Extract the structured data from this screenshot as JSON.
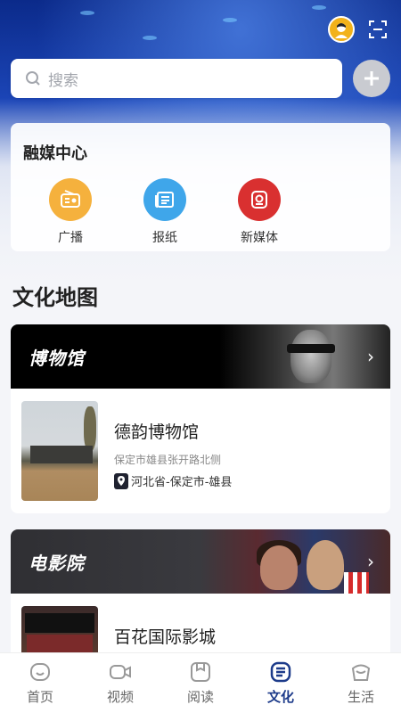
{
  "search": {
    "placeholder": "搜索"
  },
  "media_center": {
    "title": "融媒中心",
    "items": [
      {
        "label": "广播",
        "icon": "radio-icon",
        "color": "#f5b13d"
      },
      {
        "label": "报纸",
        "icon": "newspaper-icon",
        "color": "#3fa6ea"
      },
      {
        "label": "新媒体",
        "icon": "new-media-icon",
        "color": "#d93030"
      }
    ]
  },
  "culture_map": {
    "title": "文化地图",
    "categories": [
      {
        "label": "博物馆",
        "venue": {
          "name": "德韵博物馆",
          "address": "保定市雄县张开路北侧",
          "region": "河北省-保定市-雄县"
        }
      },
      {
        "label": "电影院",
        "venue": {
          "name": "百花国际影城"
        }
      }
    ]
  },
  "tabbar": {
    "active": "文化",
    "accent": "#1d3b8a",
    "items": [
      {
        "label": "首页",
        "icon": "home-icon"
      },
      {
        "label": "视频",
        "icon": "video-icon"
      },
      {
        "label": "阅读",
        "icon": "reading-icon"
      },
      {
        "label": "文化",
        "icon": "culture-icon"
      },
      {
        "label": "生活",
        "icon": "life-icon"
      }
    ]
  }
}
